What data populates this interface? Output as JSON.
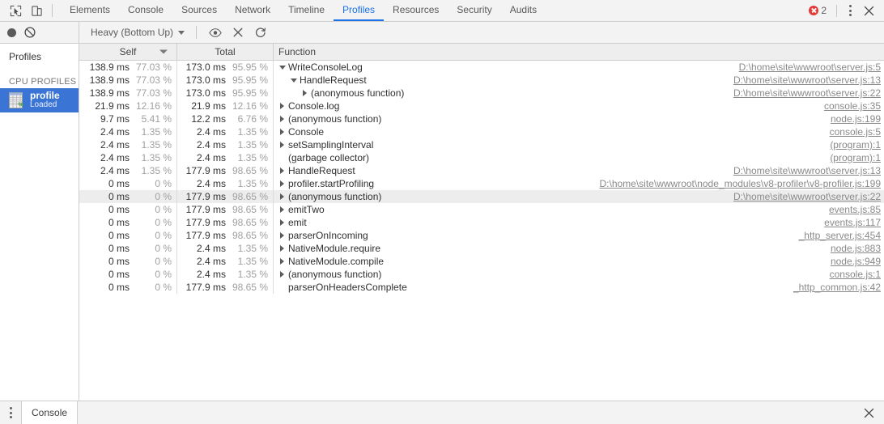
{
  "tabbar": {
    "icons": [
      {
        "name": "inspect-element-icon"
      },
      {
        "name": "device-toolbar-icon"
      }
    ],
    "tabs": [
      {
        "label": "Elements",
        "active": false
      },
      {
        "label": "Console",
        "active": false
      },
      {
        "label": "Sources",
        "active": false
      },
      {
        "label": "Network",
        "active": false
      },
      {
        "label": "Timeline",
        "active": false
      },
      {
        "label": "Profiles",
        "active": true
      },
      {
        "label": "Resources",
        "active": false
      },
      {
        "label": "Security",
        "active": false
      },
      {
        "label": "Audits",
        "active": false
      }
    ],
    "error_count": "2",
    "error_color": "#e53935",
    "active_tab_color": "#1a73e8"
  },
  "toolbar": {
    "record_label": "record-button",
    "clear_label": "clear-button",
    "view_select": "Heavy (Bottom Up)",
    "buttons": [
      {
        "name": "focus-selected-function-icon"
      },
      {
        "name": "exclude-selected-function-icon"
      },
      {
        "name": "restore-all-functions-icon"
      }
    ]
  },
  "sidebar": {
    "title": "Profiles",
    "group_label": "CPU PROFILES",
    "selected_color": "#3a75d6",
    "items": [
      {
        "name": "profile",
        "status": "Loaded",
        "selected": true
      }
    ]
  },
  "grid": {
    "columns": [
      {
        "key": "self",
        "label": "Self",
        "sorted": true,
        "sort_dir": "desc"
      },
      {
        "key": "total",
        "label": "Total",
        "sorted": false
      },
      {
        "key": "function",
        "label": "Function",
        "sorted": false
      }
    ],
    "rows": [
      {
        "self_ms": "138.9 ms",
        "self_pct": "77.03 %",
        "total_ms": "173.0 ms",
        "total_pct": "95.95 %",
        "depth": 0,
        "expander": "down",
        "function": "WriteConsoleLog",
        "url": "D:\\home\\site\\wwwroot\\server.js:5",
        "highlighted": false
      },
      {
        "self_ms": "138.9 ms",
        "self_pct": "77.03 %",
        "total_ms": "173.0 ms",
        "total_pct": "95.95 %",
        "depth": 1,
        "expander": "down",
        "function": "HandleRequest",
        "url": "D:\\home\\site\\wwwroot\\server.js:13",
        "highlighted": false
      },
      {
        "self_ms": "138.9 ms",
        "self_pct": "77.03 %",
        "total_ms": "173.0 ms",
        "total_pct": "95.95 %",
        "depth": 2,
        "expander": "right",
        "function": "(anonymous function)",
        "url": "D:\\home\\site\\wwwroot\\server.js:22",
        "highlighted": false
      },
      {
        "self_ms": "21.9 ms",
        "self_pct": "12.16 %",
        "total_ms": "21.9 ms",
        "total_pct": "12.16 %",
        "depth": 0,
        "expander": "right",
        "function": "Console.log",
        "url": "console.js:35",
        "highlighted": false
      },
      {
        "self_ms": "9.7 ms",
        "self_pct": "5.41 %",
        "total_ms": "12.2 ms",
        "total_pct": "6.76 %",
        "depth": 0,
        "expander": "right",
        "function": "(anonymous function)",
        "url": "node.js:199",
        "highlighted": false
      },
      {
        "self_ms": "2.4 ms",
        "self_pct": "1.35 %",
        "total_ms": "2.4 ms",
        "total_pct": "1.35 %",
        "depth": 0,
        "expander": "right",
        "function": "Console",
        "url": "console.js:5",
        "highlighted": false
      },
      {
        "self_ms": "2.4 ms",
        "self_pct": "1.35 %",
        "total_ms": "2.4 ms",
        "total_pct": "1.35 %",
        "depth": 0,
        "expander": "right",
        "function": "setSamplingInterval",
        "url": "(program):1",
        "highlighted": false
      },
      {
        "self_ms": "2.4 ms",
        "self_pct": "1.35 %",
        "total_ms": "2.4 ms",
        "total_pct": "1.35 %",
        "depth": 0,
        "expander": "none",
        "function": "(garbage collector)",
        "url": "(program):1",
        "highlighted": false
      },
      {
        "self_ms": "2.4 ms",
        "self_pct": "1.35 %",
        "total_ms": "177.9 ms",
        "total_pct": "98.65 %",
        "depth": 0,
        "expander": "right",
        "function": "HandleRequest",
        "url": "D:\\home\\site\\wwwroot\\server.js:13",
        "highlighted": false
      },
      {
        "self_ms": "0 ms",
        "self_pct": "0 %",
        "total_ms": "2.4 ms",
        "total_pct": "1.35 %",
        "depth": 0,
        "expander": "right",
        "function": "profiler.startProfiling",
        "url": "D:\\home\\site\\wwwroot\\node_modules\\v8-profiler\\v8-profiler.js:199",
        "highlighted": false
      },
      {
        "self_ms": "0 ms",
        "self_pct": "0 %",
        "total_ms": "177.9 ms",
        "total_pct": "98.65 %",
        "depth": 0,
        "expander": "right",
        "function": "(anonymous function)",
        "url": "D:\\home\\site\\wwwroot\\server.js:22",
        "highlighted": true
      },
      {
        "self_ms": "0 ms",
        "self_pct": "0 %",
        "total_ms": "177.9 ms",
        "total_pct": "98.65 %",
        "depth": 0,
        "expander": "right",
        "function": "emitTwo",
        "url": "events.js:85",
        "highlighted": false
      },
      {
        "self_ms": "0 ms",
        "self_pct": "0 %",
        "total_ms": "177.9 ms",
        "total_pct": "98.65 %",
        "depth": 0,
        "expander": "right",
        "function": "emit",
        "url": "events.js:117",
        "highlighted": false
      },
      {
        "self_ms": "0 ms",
        "self_pct": "0 %",
        "total_ms": "177.9 ms",
        "total_pct": "98.65 %",
        "depth": 0,
        "expander": "right",
        "function": "parserOnIncoming",
        "url": "_http_server.js:454",
        "highlighted": false
      },
      {
        "self_ms": "0 ms",
        "self_pct": "0 %",
        "total_ms": "2.4 ms",
        "total_pct": "1.35 %",
        "depth": 0,
        "expander": "right",
        "function": "NativeModule.require",
        "url": "node.js:883",
        "highlighted": false
      },
      {
        "self_ms": "0 ms",
        "self_pct": "0 %",
        "total_ms": "2.4 ms",
        "total_pct": "1.35 %",
        "depth": 0,
        "expander": "right",
        "function": "NativeModule.compile",
        "url": "node.js:949",
        "highlighted": false
      },
      {
        "self_ms": "0 ms",
        "self_pct": "0 %",
        "total_ms": "2.4 ms",
        "total_pct": "1.35 %",
        "depth": 0,
        "expander": "right",
        "function": "(anonymous function)",
        "url": "console.js:1",
        "highlighted": false
      },
      {
        "self_ms": "0 ms",
        "self_pct": "0 %",
        "total_ms": "177.9 ms",
        "total_pct": "98.65 %",
        "depth": 0,
        "expander": "none",
        "function": "parserOnHeadersComplete",
        "url": "_http_common.js:42",
        "highlighted": false
      }
    ]
  },
  "drawer": {
    "tabs": [
      {
        "label": "Console",
        "active": true
      }
    ],
    "close_label": "close-drawer"
  }
}
